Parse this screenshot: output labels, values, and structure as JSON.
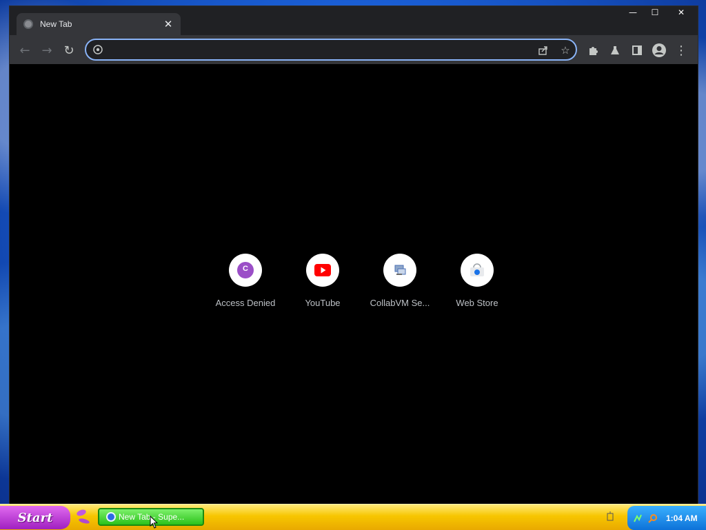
{
  "window": {
    "tab_title": "New Tab",
    "tab_close": "✕",
    "minimize": "—",
    "maximize": "☐",
    "close": "✕"
  },
  "toolbar": {
    "back": "←",
    "forward": "→",
    "reload": "↻",
    "omnibox_value": "",
    "share": "⇪",
    "bookmark": "☆",
    "extensions": "puzzle-icon",
    "labs": "flask-icon",
    "side_panel": "side-panel-icon",
    "profile": "profile-icon",
    "menu": "⋮"
  },
  "shortcuts": [
    {
      "label": "Access Denied",
      "icon": "c-letter-icon",
      "color": "#9b4fc7"
    },
    {
      "label": "YouTube",
      "icon": "youtube-icon",
      "color": "#ff0000"
    },
    {
      "label": "CollabVM Se...",
      "icon": "collabvm-icon",
      "color": "#4a6fb5"
    },
    {
      "label": "Web Store",
      "icon": "web-store-icon",
      "color": "#1a73e8"
    }
  ],
  "taskbar": {
    "start_label": "Start",
    "task_label": "New Tab - Supe...",
    "clock": "1:04 AM"
  },
  "colors": {
    "accent": "#8ab4f8",
    "taskbar": "#f7c600",
    "start": "#b02ed0",
    "task_button": "#2bc21a",
    "tray": "#0d72d8"
  }
}
